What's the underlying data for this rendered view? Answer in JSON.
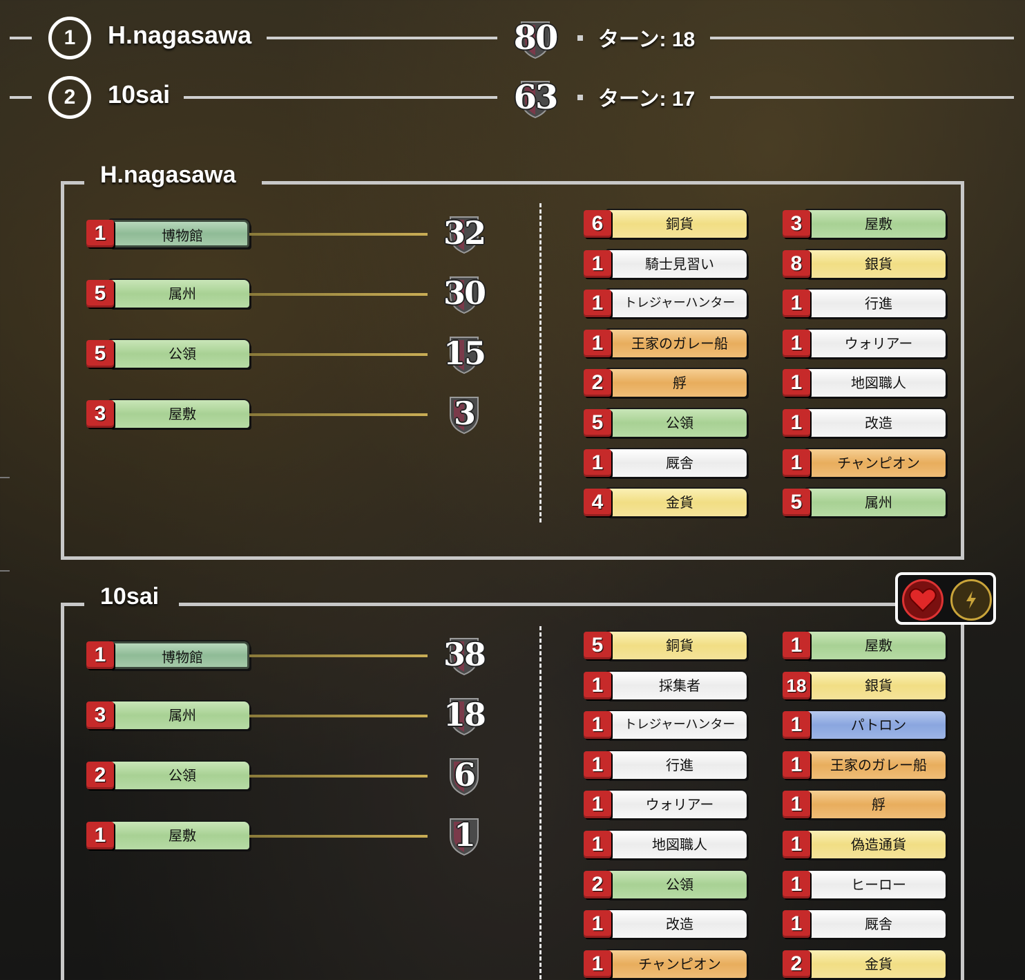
{
  "ranking": [
    {
      "rank": "1",
      "name": "H.nagasawa",
      "score": "80",
      "turn": "ターン: 18"
    },
    {
      "rank": "2",
      "name": "10sai",
      "score": "63",
      "turn": "ターン: 17"
    }
  ],
  "players": [
    {
      "name": "H.nagasawa",
      "scores": [
        {
          "count": "1",
          "label": "博物館",
          "points": "32",
          "color": "museum"
        },
        {
          "count": "5",
          "label": "属州",
          "points": "30",
          "color": "green"
        },
        {
          "count": "5",
          "label": "公領",
          "points": "15",
          "color": "green"
        },
        {
          "count": "3",
          "label": "屋敷",
          "points": "3",
          "color": "green"
        }
      ],
      "cards_left": [
        {
          "count": "6",
          "label": "銅貨",
          "color": "gold"
        },
        {
          "count": "1",
          "label": "騎士見習い",
          "color": "white"
        },
        {
          "count": "1",
          "label": "トレジャーハンター",
          "color": "white"
        },
        {
          "count": "1",
          "label": "王家のガレー船",
          "color": "orange"
        },
        {
          "count": "2",
          "label": "艀",
          "color": "orange"
        },
        {
          "count": "5",
          "label": "公領",
          "color": "green"
        },
        {
          "count": "1",
          "label": "厩舎",
          "color": "white"
        },
        {
          "count": "4",
          "label": "金貨",
          "color": "gold"
        }
      ],
      "cards_right": [
        {
          "count": "3",
          "label": "屋敷",
          "color": "green"
        },
        {
          "count": "8",
          "label": "銀貨",
          "color": "gold"
        },
        {
          "count": "1",
          "label": "行進",
          "color": "white"
        },
        {
          "count": "1",
          "label": "ウォリアー",
          "color": "white"
        },
        {
          "count": "1",
          "label": "地図職人",
          "color": "white"
        },
        {
          "count": "1",
          "label": "改造",
          "color": "white"
        },
        {
          "count": "1",
          "label": "チャンピオン",
          "color": "orange"
        },
        {
          "count": "5",
          "label": "属州",
          "color": "green"
        }
      ]
    },
    {
      "name": "10sai",
      "scores": [
        {
          "count": "1",
          "label": "博物館",
          "points": "38",
          "color": "museum"
        },
        {
          "count": "3",
          "label": "属州",
          "points": "18",
          "color": "green"
        },
        {
          "count": "2",
          "label": "公領",
          "points": "6",
          "color": "green"
        },
        {
          "count": "1",
          "label": "屋敷",
          "points": "1",
          "color": "green"
        }
      ],
      "cards_left": [
        {
          "count": "5",
          "label": "銅貨",
          "color": "gold"
        },
        {
          "count": "1",
          "label": "採集者",
          "color": "white"
        },
        {
          "count": "1",
          "label": "トレジャーハンター",
          "color": "white"
        },
        {
          "count": "1",
          "label": "行進",
          "color": "white"
        },
        {
          "count": "1",
          "label": "ウォリアー",
          "color": "white"
        },
        {
          "count": "1",
          "label": "地図職人",
          "color": "white"
        },
        {
          "count": "2",
          "label": "公領",
          "color": "green"
        },
        {
          "count": "1",
          "label": "改造",
          "color": "white"
        },
        {
          "count": "1",
          "label": "チャンピオン",
          "color": "orange"
        }
      ],
      "cards_right": [
        {
          "count": "1",
          "label": "屋敷",
          "color": "green"
        },
        {
          "count": "18",
          "label": "銀貨",
          "color": "gold"
        },
        {
          "count": "1",
          "label": "パトロン",
          "color": "blue"
        },
        {
          "count": "1",
          "label": "王家のガレー船",
          "color": "orange"
        },
        {
          "count": "1",
          "label": "艀",
          "color": "orange"
        },
        {
          "count": "1",
          "label": "偽造通貨",
          "color": "gold"
        },
        {
          "count": "1",
          "label": "ヒーロー",
          "color": "white"
        },
        {
          "count": "1",
          "label": "厩舎",
          "color": "white"
        },
        {
          "count": "2",
          "label": "金貨",
          "color": "gold"
        }
      ],
      "status_icons": [
        "heart-icon",
        "bolt-icon"
      ]
    }
  ],
  "colors": {
    "count_badge": "#c62a2a",
    "green": "#a8d194",
    "gold": "#f1de84",
    "white": "#ececec",
    "orange": "#e8ad5d",
    "blue": "#8aa6df",
    "museum": "#8fbb96"
  }
}
